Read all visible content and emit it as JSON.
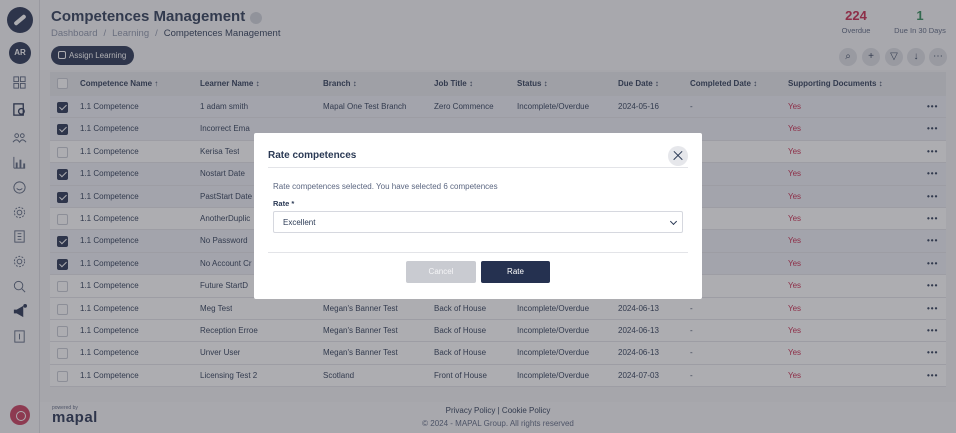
{
  "sidebar": {
    "avatar_initials": "AR",
    "icons": [
      "dashboard-icon",
      "search-doc-icon",
      "people-icon",
      "chart-icon",
      "smiley-icon",
      "gear-icon",
      "building-icon",
      "settings-icon",
      "search-icon",
      "megaphone-icon",
      "document-icon"
    ]
  },
  "header": {
    "title": "Competences Management",
    "breadcrumb": [
      "Dashboard",
      "Learning",
      "Competences Management"
    ],
    "stats": [
      {
        "value": "224",
        "label": "Overdue",
        "color": "#c8254a"
      },
      {
        "value": "1",
        "label": "Due In 30 Days",
        "color": "#2e8b57"
      }
    ],
    "assign_label": "Assign Learning"
  },
  "table": {
    "columns": [
      "Competence Name ↑",
      "Learner Name ↕",
      "Branch ↕",
      "Job Title ↕",
      "Status ↕",
      "Due Date ↕",
      "Completed Date ↕",
      "Supporting Documents ↕"
    ],
    "rows": [
      {
        "checked": true,
        "competence": "1.1 Competence",
        "learner": "1 adam smith",
        "branch": "Mapal One Test Branch",
        "job": "Zero Commence",
        "status": "Incomplete/Overdue",
        "due": "2024-05-16",
        "completed": "-",
        "docs": "Yes"
      },
      {
        "checked": true,
        "competence": "1.1 Competence",
        "learner": "Incorrect Ema",
        "branch": "",
        "job": "",
        "status": "",
        "due": "",
        "completed": "",
        "docs": "Yes"
      },
      {
        "checked": false,
        "competence": "1.1 Competence",
        "learner": "Kerisa Test",
        "branch": "",
        "job": "",
        "status": "",
        "due": "",
        "completed": "",
        "docs": "Yes"
      },
      {
        "checked": true,
        "competence": "1.1 Competence",
        "learner": "Nostart Date",
        "branch": "",
        "job": "",
        "status": "",
        "due": "",
        "completed": "",
        "docs": "Yes"
      },
      {
        "checked": true,
        "competence": "1.1 Competence",
        "learner": "PastStart Date",
        "branch": "",
        "job": "",
        "status": "",
        "due": "",
        "completed": "",
        "docs": "Yes"
      },
      {
        "checked": false,
        "competence": "1.1 Competence",
        "learner": "AnotherDuplic",
        "branch": "",
        "job": "",
        "status": "",
        "due": "",
        "completed": "",
        "docs": "Yes"
      },
      {
        "checked": true,
        "competence": "1.1 Competence",
        "learner": "No Password",
        "branch": "",
        "job": "",
        "status": "",
        "due": "",
        "completed": "",
        "docs": "Yes"
      },
      {
        "checked": true,
        "competence": "1.1 Competence",
        "learner": "No Account Cr",
        "branch": "",
        "job": "",
        "status": "",
        "due": "",
        "completed": "",
        "docs": "Yes"
      },
      {
        "checked": false,
        "competence": "1.1 Competence",
        "learner": "Future StartD",
        "branch": "",
        "job": "",
        "status": "",
        "due": "",
        "completed": "",
        "docs": "Yes"
      },
      {
        "checked": false,
        "competence": "1.1 Competence",
        "learner": "Meg Test",
        "branch": "Megan's Banner Test",
        "job": "Back of House",
        "status": "Incomplete/Overdue",
        "due": "2024-06-13",
        "completed": "-",
        "docs": "Yes"
      },
      {
        "checked": false,
        "competence": "1.1 Competence",
        "learner": "Reception Erroe",
        "branch": "Megan's Banner Test",
        "job": "Back of House",
        "status": "Incomplete/Overdue",
        "due": "2024-06-13",
        "completed": "-",
        "docs": "Yes"
      },
      {
        "checked": false,
        "competence": "1.1 Competence",
        "learner": "Unver User",
        "branch": "Megan's Banner Test",
        "job": "Back of House",
        "status": "Incomplete/Overdue",
        "due": "2024-06-13",
        "completed": "-",
        "docs": "Yes"
      },
      {
        "checked": false,
        "competence": "1.1 Competence",
        "learner": "Licensing Test 2",
        "branch": "Scotland",
        "job": "Front of House",
        "status": "Incomplete/Overdue",
        "due": "2024-07-03",
        "completed": "-",
        "docs": "Yes"
      }
    ],
    "row_action": "•••"
  },
  "footer": {
    "links": "Privacy Policy | Cookie Policy",
    "copyright": "© 2024 - MAPAL Group. All rights reserved",
    "powered_by": "powered by",
    "brand": "mapal"
  },
  "modal": {
    "title": "Rate competences",
    "message": "Rate competences selected. You have selected 6 competences",
    "rate_label": "Rate *",
    "rate_value": "Excellent",
    "cancel_label": "Cancel",
    "rate_button": "Rate"
  }
}
